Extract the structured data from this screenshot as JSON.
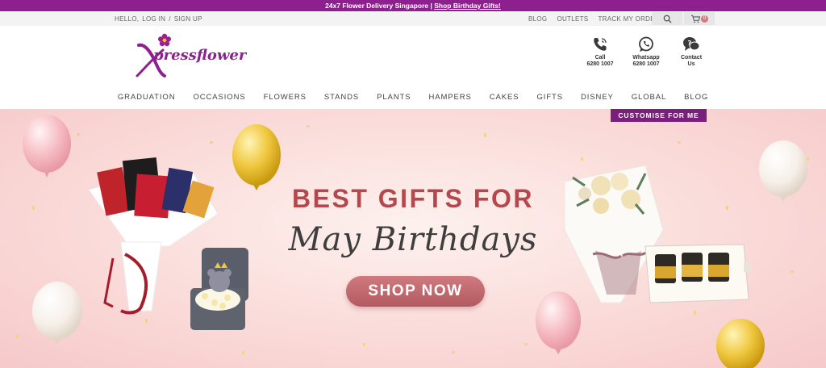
{
  "promo": {
    "text": "24x7 Flower Delivery Singapore | ",
    "link": "Shop Birthday Gifts!"
  },
  "util": {
    "hello": "HELLO,",
    "login": "LOG IN",
    "sep": "/",
    "signup": "SIGN UP",
    "blog": "BLOG",
    "outlets": "OUTLETS",
    "track": "TRACK MY ORDER",
    "cart_count": "0"
  },
  "brand": {
    "name": "Xpressflower",
    "accent": "#8e1f8e"
  },
  "contacts": [
    {
      "label": "Call",
      "sub": "6280 1007",
      "icon": "phone-icon"
    },
    {
      "label": "Whatsapp",
      "sub": "6280 1007",
      "icon": "whatsapp-icon"
    },
    {
      "label": "Contact",
      "sub": "Us",
      "icon": "chat-icon"
    }
  ],
  "nav": [
    "GRADUATION",
    "OCCASIONS",
    "FLOWERS",
    "STANDS",
    "PLANTS",
    "HAMPERS",
    "CAKES",
    "GIFTS",
    "DISNEY",
    "GLOBAL",
    "BLOG"
  ],
  "customise": "CUSTOMISE FOR ME",
  "hero": {
    "title1": "BEST GIFTS FOR",
    "title2": "May Birthdays",
    "cta": "SHOP NOW",
    "colors": {
      "title": "#b5484d",
      "cta": "#c06a70"
    }
  }
}
